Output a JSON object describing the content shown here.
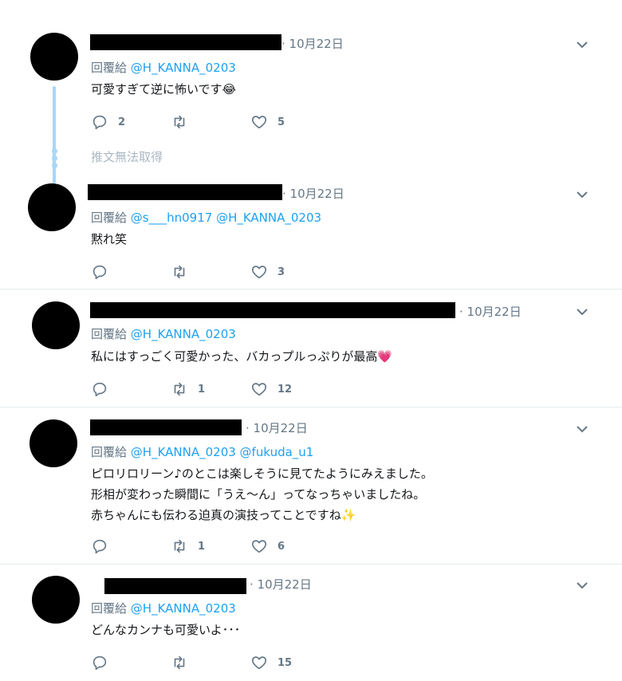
{
  "tweets": [
    {
      "date": "10月22日",
      "reply_prefix": "回覆給",
      "mentions": "@H_KANNA_0203",
      "text_lines": [
        "可愛すぎて逆に怖いです😂"
      ],
      "replies": "2",
      "retweets": "",
      "likes": "5"
    },
    {
      "date": "10月22日",
      "reply_prefix": "回覆給",
      "mentions": "@s___hn0917 @H_KANNA_0203",
      "text_lines": [
        "黙れ笑"
      ],
      "replies": "",
      "retweets": "",
      "likes": "3"
    },
    {
      "date": "10月22日",
      "reply_prefix": "回覆給",
      "mentions": "@H_KANNA_0203",
      "text_lines": [
        "私にはすっごく可愛かった、バカっプルっぷりが最高💗"
      ],
      "replies": "",
      "retweets": "1",
      "likes": "12"
    },
    {
      "date": "10月22日",
      "reply_prefix": "回覆給",
      "mentions": "@H_KANNA_0203 @fukuda_u1",
      "text_lines": [
        "ピロリロリーン♪のとこは楽しそうに見てたようにみえました。",
        "形相が変わった瞬間に「うえ〜ん」ってなっちゃいましたね。",
        "赤ちゃんにも伝わる迫真の演技ってことですね✨"
      ],
      "replies": "",
      "retweets": "1",
      "likes": "6"
    },
    {
      "date": "10月22日",
      "reply_prefix": "回覆給",
      "mentions": "@H_KANNA_0203",
      "text_lines": [
        "どんなカンナも可愛いよ･･･"
      ],
      "replies": "",
      "retweets": "",
      "likes": "15"
    }
  ],
  "thread": {
    "unavailable_text": "推文無法取得"
  },
  "icons": {
    "reply": "reply-icon",
    "retweet": "retweet-icon",
    "like": "heart-icon",
    "more": "chevron-down-icon"
  },
  "colors": {
    "link": "#1da1f2",
    "muted": "#657786",
    "thread_line": "#a8d7f7"
  }
}
